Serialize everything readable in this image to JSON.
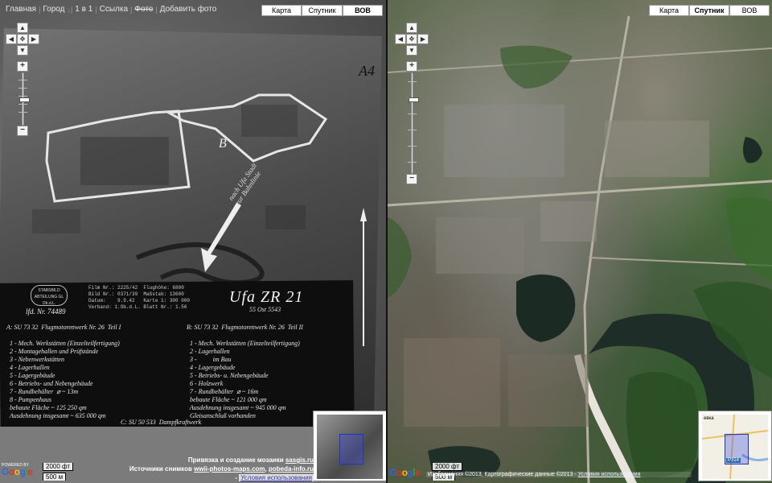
{
  "nav": {
    "home": "Главная",
    "city": "Город",
    "one_in_one": "1 в 1",
    "link": "Ссылка",
    "photo": "Фото",
    "add_photo": "Добавить фото"
  },
  "map_types": {
    "map": "Карта",
    "satellite": "Спутник",
    "wow": "ВОВ"
  },
  "archive": {
    "corner_mark": "А4",
    "zone_label": "В",
    "title": "Ufa  ZR 21",
    "subtitle": "55 Ost  5543",
    "stamp": "STABSBILD ABTEILUNG GL Ob.d.L.",
    "lfd": "lfd. Nr. 74489",
    "film_block": "Film Nr.: 2225/42  Flughöhe: 6800\nBild Nr.: 0371/39  Maßstab: 13600\nDatum:    9.9.42   Karte 1: 300 000\nVerband: 1.Ob.d.L. Blatt Nr.: 1.56",
    "handwriting": "nach Ufa Stadt\nzur Bahnlinie",
    "legend_a": "A: SU 73 32  Flugmotorenwerk Nr. 26  Teil I\n\n  1 - Mech. Werkstätten (Einzelteilfertigung)\n  2 - Montagehallen und Prüfstände\n  3 - Nebenwerkstätten\n  4 - Lagerhallen\n  5 - Lagergebäude\n  6 - Betriebs- und Nebengebäude\n  7 - Rundbehälter  ⌀ ~ 13m\n  8 - Pumpenhaus\n  bebaute Fläche ~ 125 250 qm\n  Ausdehnung insgesamt ~ 635 000 qm",
    "legend_b": "B: SU 73 32  Flugmotorenwerk Nr. 26  Teil II\n\n  1 - Mech. Werkstätten (Einzelteilfertigung)\n  2 - Lagerhallen\n  3 -          im Bau\n  4 - Lagergebäude\n  5 - Betriebs- u. Nebengebäude\n  6 - Holzwerk\n  7 - Rundbehälter  ⌀ ~ 16m\n  bebaute Fläche ~ 121 000 qm\n  Ausdehnung insgesamt ~ 945 000 qm\n  Gleisanschluß vorhanden",
    "legend_c": "C: SU 50 533  Dampfkraftwerk"
  },
  "scale": {
    "feet": "2000 фт",
    "meters": "500 м"
  },
  "credits_left": {
    "line1_prefix": "Привязка и создание мозаики ",
    "line1_link": "sasgis.ru",
    "line2_prefix": "Источники снимков ",
    "line2_link1": "wwii-photos-maps.com",
    "line2_sep": ", ",
    "line2_link2": "pobeda-info.ru",
    "terms": "Условия использования"
  },
  "credits_right": {
    "text": "Изображения ©2013,  Картографические данные ©2013 -",
    "terms": "Условия использования"
  },
  "google": {
    "powered_by": "POWERED BY",
    "g": "G",
    "o1": "o",
    "o2": "o",
    "g2": "g",
    "l": "l",
    "e": "e"
  },
  "overview_right": {
    "place_label": "евка",
    "road_badge": "Р314"
  }
}
